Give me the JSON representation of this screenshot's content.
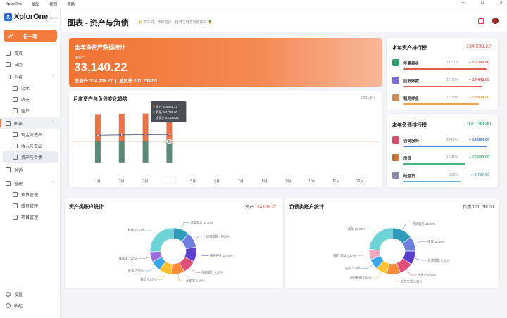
{
  "menubar": {
    "items": [
      "XplorOne",
      "编辑",
      "视图",
      "帮助"
    ],
    "controls": [
      "—",
      "☐",
      "✕"
    ]
  },
  "app": {
    "name": "XplorOne",
    "version": "v0.6.0",
    "logo_letter": "X"
  },
  "sidebar": {
    "record_button": "记一笔",
    "items": [
      {
        "label": "首页",
        "icon": "home-icon",
        "kind": "top"
      },
      {
        "label": "日历",
        "icon": "calendar-icon",
        "kind": "top"
      },
      {
        "label": "列表",
        "icon": "list-icon",
        "kind": "group",
        "arrow": "^"
      },
      {
        "label": "流水",
        "icon": "flow-icon",
        "kind": "sub"
      },
      {
        "label": "收支",
        "icon": "income-icon",
        "kind": "sub"
      },
      {
        "label": "账户",
        "icon": "account-icon",
        "kind": "sub"
      },
      {
        "label": "图表",
        "icon": "chart-icon",
        "kind": "group-active",
        "arrow": "^"
      },
      {
        "label": "现金流进出",
        "icon": "cashflow-icon",
        "kind": "sub"
      },
      {
        "label": "收入与支出",
        "icon": "income-expense-icon",
        "kind": "sub"
      },
      {
        "label": "资产与负债",
        "icon": "asset-liability-icon",
        "kind": "sub-selected"
      },
      {
        "label": "对话",
        "icon": "chat-icon",
        "kind": "top"
      },
      {
        "label": "管理",
        "icon": "manage-icon",
        "kind": "group",
        "arrow": "^"
      },
      {
        "label": "预算管理",
        "icon": "budget-icon",
        "kind": "sub"
      },
      {
        "label": "成员管理",
        "icon": "member-icon",
        "kind": "sub"
      },
      {
        "label": "项目管理",
        "icon": "project-icon",
        "kind": "sub"
      }
    ],
    "bottom": [
      {
        "label": "设置",
        "icon": "settings-icon"
      },
      {
        "label": "收起",
        "icon": "collapse-icon"
      }
    ]
  },
  "header": {
    "title": "图表 - 资产与负债",
    "slogan": "🌾 下午好，不积跬步，拾日之时方有收获时 🍍"
  },
  "hero": {
    "title": "全年净资产数据统计",
    "label": "净资产",
    "value": "33,140.22",
    "summary": "总资产 134,938.22  |  总负债 101,798.00"
  },
  "trend": {
    "title": "月度资产与负债变化趋势",
    "year": "2026年",
    "tooltip": {
      "title": "4月",
      "rows": [
        {
          "label": "资产 134,938.22",
          "color": "#e8724a"
        },
        {
          "label": "负债 101,798.00",
          "color": "#5b8a74"
        },
        {
          "label": "净资产 33,140.22",
          "color": "#3a4f7a"
        }
      ]
    }
  },
  "chart_data": {
    "type": "bar",
    "categories": [
      "1月",
      "2月",
      "3月",
      "4月",
      "5月",
      "6月",
      "7月",
      "8月",
      "9月",
      "10月",
      "11月",
      "12月"
    ],
    "series": [
      {
        "name": "资产",
        "values": [
          131500,
          133000,
          134200,
          134938.22,
          null,
          null,
          null,
          null,
          null,
          null,
          null,
          null
        ],
        "color": "#e8724a"
      },
      {
        "name": "负债",
        "values": [
          -101798,
          -101798,
          -101798,
          -101798,
          null,
          null,
          null,
          null,
          null,
          null,
          null,
          null
        ],
        "color": "#5b8a74"
      },
      {
        "name": "净资产",
        "values": [
          29700,
          31200,
          32400,
          33140.22,
          null,
          null,
          null,
          null,
          null,
          null,
          null,
          null
        ],
        "color": "#3a4f7a"
      }
    ],
    "ylim": [
      -130000,
      160000
    ],
    "title": "月度资产与负债变化趋势",
    "xlabel": "",
    "ylabel": ""
  },
  "asset_rank": {
    "title": "本年资产排行榜",
    "total": "134,938.22",
    "rows": [
      {
        "name": "华夏基金",
        "pct": "11.37%",
        "amount": "+ 15,346.50",
        "fill": 0.97,
        "color": "#e35d4a",
        "icon_bg": "#2e9e6b"
      },
      {
        "name": "应收账款",
        "pct": "10.70%",
        "amount": "+ 14,445.00",
        "fill": 0.92,
        "color": "#e35d4a",
        "icon_bg": "#7a6fd8"
      },
      {
        "name": "租房押金",
        "pct": "10.30%",
        "amount": "+ 13,904.00",
        "fill": 0.88,
        "color": "#f0a24a",
        "icon_bg": "#c98a52"
      }
    ]
  },
  "liab_rank": {
    "title": "本年负债排行榜",
    "total": "101,798.00",
    "rows": [
      {
        "name": "咨询服务",
        "pct": "14.60%",
        "amount": "+ 14,864.00",
        "fill": 0.97,
        "color": "#4a7be0",
        "icon_bg": "#d64c6b"
      },
      {
        "name": "房贷",
        "pct": "10.45%",
        "amount": "+ 10,640.00",
        "fill": 0.72,
        "color": "#48b37a",
        "icon_bg": "#c4733a"
      },
      {
        "name": "经营贷",
        "pct": "9.62%",
        "amount": "+ 9,797.00",
        "fill": 0.66,
        "color": "#5fb8c8",
        "icon_bg": "#8a8aa8"
      }
    ]
  },
  "asset_pie": {
    "title": "资产类账户统计",
    "total_label": "资产",
    "total_value": "134,938.22",
    "slices": [
      {
        "label": "华夏基金 11.37%",
        "value": 11.37,
        "color": "#2e9bb8"
      },
      {
        "label": "应收账款 10.66%",
        "value": 10.66,
        "color": "#6f7fe0"
      },
      {
        "label": "租房押金 10.31%",
        "value": 10.31,
        "color": "#5b3fd0"
      },
      {
        "label": "招商银行 9.56%",
        "value": 9.56,
        "color": "#e0517a"
      },
      {
        "label": "余额宝 9.19%",
        "value": 9.19,
        "color": "#ff8a3a"
      },
      {
        "label": "微信 8.63%",
        "value": 8.63,
        "color": "#ffc233"
      },
      {
        "label": "现金 7.27%",
        "value": 7.27,
        "color": "#3ba7e8"
      },
      {
        "label": "储蓄卡 7.07%",
        "value": 7.07,
        "color": "#9b6fe0"
      },
      {
        "label": "其他 25.32%",
        "value": 25.32,
        "color": "#6ed3d6"
      }
    ]
  },
  "liab_pie": {
    "title": "负债类账户统计",
    "total_label": "负债",
    "total_value": "101,798.00",
    "slices": [
      {
        "label": "咨询服务 14.60%",
        "value": 14.6,
        "color": "#2e9bb8"
      },
      {
        "label": "房贷 10.45%",
        "value": 10.45,
        "color": "#6f7fe0"
      },
      {
        "label": "经营贷款 9.62%",
        "value": 9.62,
        "color": "#5b3fd0"
      },
      {
        "label": "信用卡 9.62%",
        "value": 9.62,
        "color": "#e0517a"
      },
      {
        "label": "应付工资 9.51%",
        "value": 9.51,
        "color": "#ff8a3a"
      },
      {
        "label": "应交税费 7.84%",
        "value": 7.84,
        "color": "#ffc233"
      },
      {
        "label": "花呗 7.44%",
        "value": 7.44,
        "color": "#3ba7e8"
      },
      {
        "label": "银行贷款 7.17%",
        "value": 7.17,
        "color": "#f4a7c0"
      },
      {
        "label": "其他 23.92%",
        "value": 23.75,
        "color": "#6ed3d6"
      }
    ]
  }
}
